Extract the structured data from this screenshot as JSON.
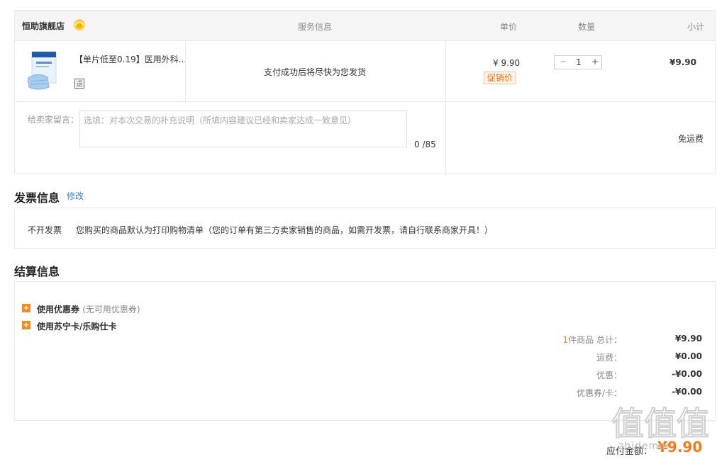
{
  "order": {
    "store_name": "恒助旗舰店",
    "headers": {
      "service": "服务信息",
      "unit_price": "单价",
      "quantity": "数量",
      "subtotal": "小计"
    },
    "item": {
      "title": "【单片低至0.19】医用外科...",
      "return_badge": "退",
      "service_text": "支付成功后将尽快为您发货",
      "price": "¥ 9.90",
      "promo_tag": "促销价",
      "qty_minus": "−",
      "qty_value": "1",
      "qty_plus": "+",
      "subtotal": "¥9.90"
    },
    "message": {
      "label": "给卖家留言：",
      "placeholder": "选填：对本次交易的补充说明（所填内容建议已经和卖家达成一致意见）",
      "counter": "0 /85"
    },
    "shipping": "免运费"
  },
  "invoice": {
    "title": "发票信息",
    "edit_label": "修改",
    "type": "不开发票",
    "description": "您购买的商品默认为打印购物清单（您的订单有第三方卖家销售的商品，如需开发票，请自行联系商家开具！）"
  },
  "settlement": {
    "title": "结算信息",
    "coupon_label": "使用优惠券",
    "coupon_hint": "(无可用优惠券)",
    "card_label": "使用苏宁卡/乐购仕卡",
    "summary": {
      "count": "1",
      "count_label": "件商品 总计：",
      "total": "¥9.90",
      "freight_label": "运费：",
      "freight": "¥0.00",
      "discount_label": "优惠：",
      "discount": "-¥0.00",
      "coupon_card_label": "优惠券/卡：",
      "coupon_card": "-¥0.00"
    }
  },
  "payment": {
    "label": "应付金额：",
    "amount": "¥9.90"
  },
  "watermark": {
    "text": "值值值",
    "url": "zhidemai"
  }
}
